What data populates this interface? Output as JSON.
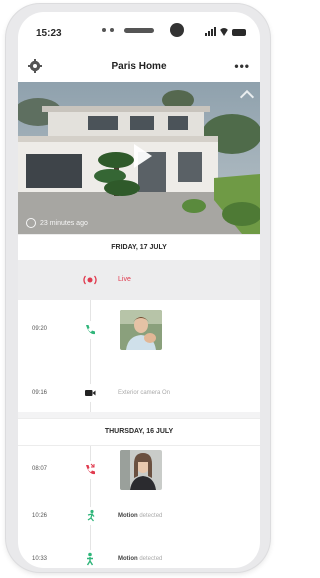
{
  "status_bar": {
    "time": "15:23"
  },
  "header": {
    "title": "Paris Home",
    "more": "•••"
  },
  "video": {
    "caption": "23 minutes ago"
  },
  "days": [
    {
      "label": "FRIDAY, 17 JULY",
      "events": [
        {
          "time": "",
          "type": "live",
          "label": "Live",
          "icon": "live-icon"
        },
        {
          "time": "09:20",
          "type": "call-answered",
          "label": "",
          "icon": "phone-icon"
        },
        {
          "time": "09:16",
          "type": "camera",
          "label": "Exterior camera On",
          "icon": "video-camera-icon"
        }
      ]
    },
    {
      "label": "THURSDAY, 16 JULY",
      "events": [
        {
          "time": "08:07",
          "type": "call-missed",
          "label": "",
          "icon": "phone-missed-icon"
        },
        {
          "time": "10:26",
          "type": "motion",
          "label": "Motion",
          "detail": "detected",
          "icon": "motion-icon"
        },
        {
          "time": "10:33",
          "type": "motion",
          "label": "Motion",
          "detail": "detected",
          "icon": "motion-person-icon"
        }
      ]
    }
  ],
  "colors": {
    "live_red": "#e03a4e",
    "call_green": "#2fb57a",
    "missed_red": "#e03a4e",
    "camera_dark": "#222222"
  }
}
